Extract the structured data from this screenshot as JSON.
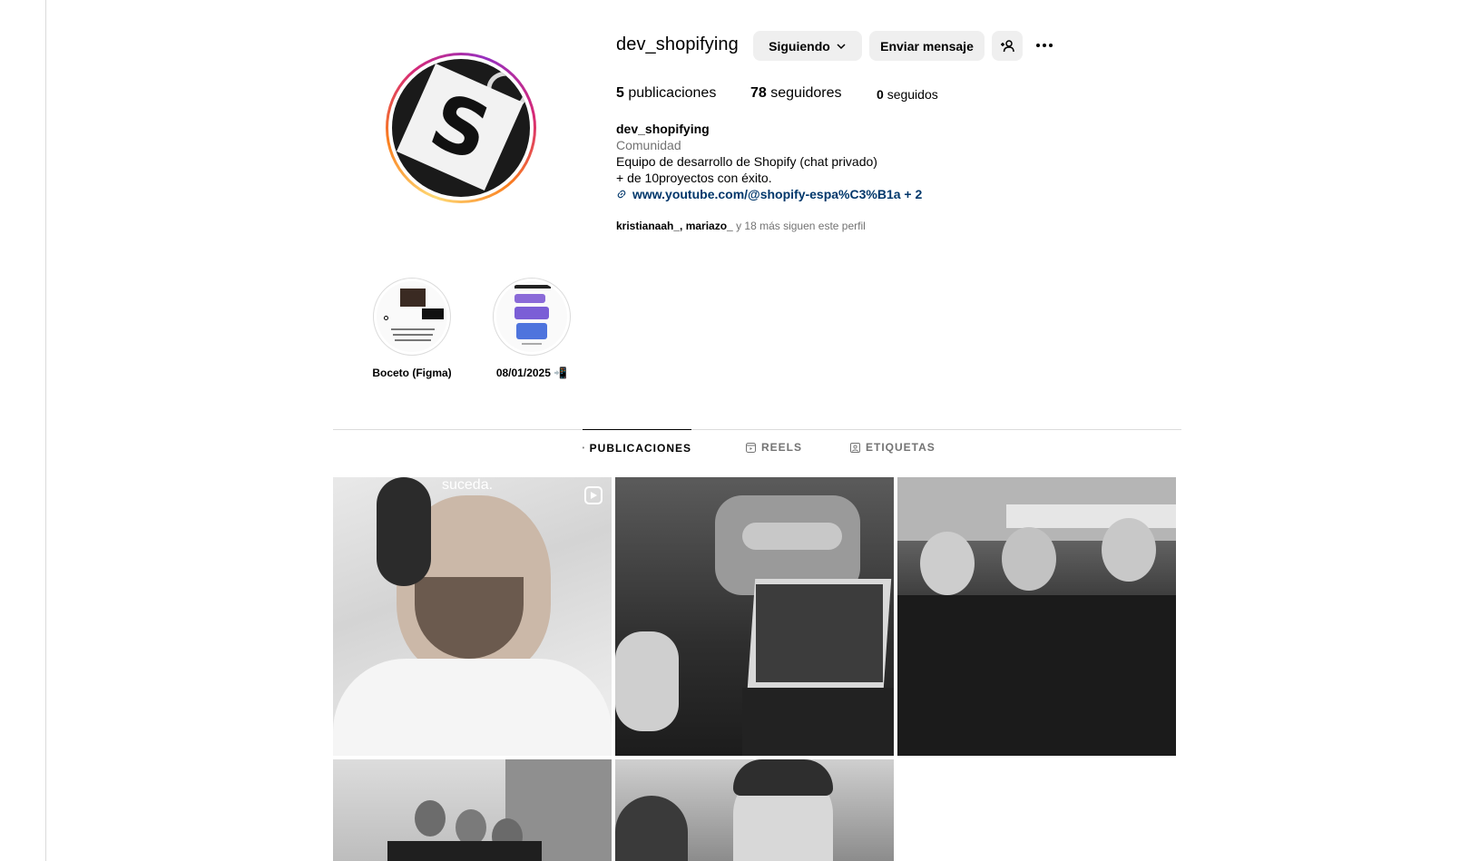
{
  "profile": {
    "username": "dev_shopifying",
    "buttons": {
      "following": "Siguiendo",
      "message": "Enviar mensaje"
    },
    "stats": {
      "posts_count": "5",
      "posts_label": "publicaciones",
      "followers_count": "78",
      "followers_label": "seguidores",
      "following_count": "0",
      "following_label": "seguidos"
    },
    "bio": {
      "name": "dev_shopifying",
      "category": "Comunidad",
      "line1": "Equipo de desarrollo de Shopify (chat privado)",
      "line2": "+ de 10proyectos con éxito.",
      "link": "www.youtube.com/@shopify-espa%C3%B1a + 2"
    },
    "followed_by": {
      "names": "kristianaah_, mariazo_",
      "suffix": " y 18 más siguen este perfil"
    }
  },
  "highlights": [
    {
      "label": "Boceto (Figma)"
    },
    {
      "label": "08/01/2025 📲"
    }
  ],
  "tabs": [
    {
      "label": "PUBLICACIONES",
      "active": true
    },
    {
      "label": "REELS",
      "active": false
    },
    {
      "label": "ETIQUETAS",
      "active": false
    }
  ],
  "posts": [
    {
      "overlay_text": "suceda.",
      "is_reel": true
    },
    {
      "is_reel": false
    },
    {
      "is_reel": false
    },
    {
      "is_reel": false
    },
    {
      "is_reel": false
    }
  ],
  "colors": {
    "link": "#00376b",
    "secondary_text": "#737373",
    "button_bg": "#efefef",
    "divider": "#dbdbdb"
  }
}
